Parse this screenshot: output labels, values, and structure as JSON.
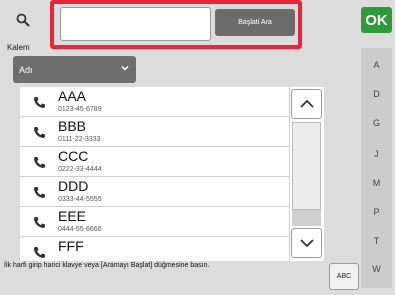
{
  "toolbar": {
    "search_icon": "search-icon",
    "search_value": "",
    "start_search_label": "Başlati Ara",
    "ok_label": "OK"
  },
  "filter": {
    "label": "Kalem",
    "selected": "Adı"
  },
  "entries": [
    {
      "name": "AAA",
      "number": "0123-45-6789"
    },
    {
      "name": "BBB",
      "number": "0111-22-3333"
    },
    {
      "name": "CCC",
      "number": "0222-33-4444"
    },
    {
      "name": "DDD",
      "number": "0333-44-5555"
    },
    {
      "name": "EEE",
      "number": "0444-55-6666"
    },
    {
      "name": "FFF",
      "number": ""
    }
  ],
  "index_keys": [
    "A",
    "D",
    "G",
    "J",
    "M",
    "P",
    "T",
    "W"
  ],
  "footer": {
    "hint": "İlk harfi girip harici klavye veya [Aramayı Başlat] düğmesine basın.",
    "abc_label": "ABC"
  },
  "colors": {
    "ok": "#2f9a3a",
    "highlight": "#e8253a",
    "select": "#6e6e6e"
  }
}
